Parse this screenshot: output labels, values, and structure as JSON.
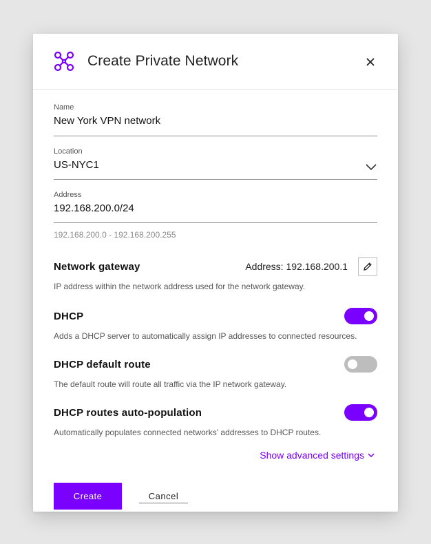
{
  "dialog": {
    "title": "Create Private Network",
    "icon": "network-icon",
    "accent_color": "#7a00ff"
  },
  "fields": {
    "name": {
      "label": "Name",
      "value": "New York VPN network"
    },
    "location": {
      "label": "Location",
      "value": "US-NYC1"
    },
    "address": {
      "label": "Address",
      "value": "192.168.200.0/24",
      "range": "192.168.200.0 - 192.168.200.255"
    }
  },
  "gateway": {
    "heading": "Network gateway",
    "address": "Address: 192.168.200.1",
    "description": "IP address within the network address used for the network gateway."
  },
  "dhcp": {
    "heading": "DHCP",
    "enabled": true,
    "description": "Adds a DHCP server to automatically assign IP addresses to connected resources."
  },
  "dhcp_default_route": {
    "heading": "DHCP default route",
    "enabled": false,
    "description": "The default route will route all traffic via the IP network gateway."
  },
  "dhcp_routes": {
    "heading": "DHCP routes auto-population",
    "enabled": true,
    "description": "Automatically populates connected networks' addresses to DHCP routes."
  },
  "advanced_link": "Show advanced settings",
  "actions": {
    "create": "Create",
    "cancel": "Cancel"
  }
}
